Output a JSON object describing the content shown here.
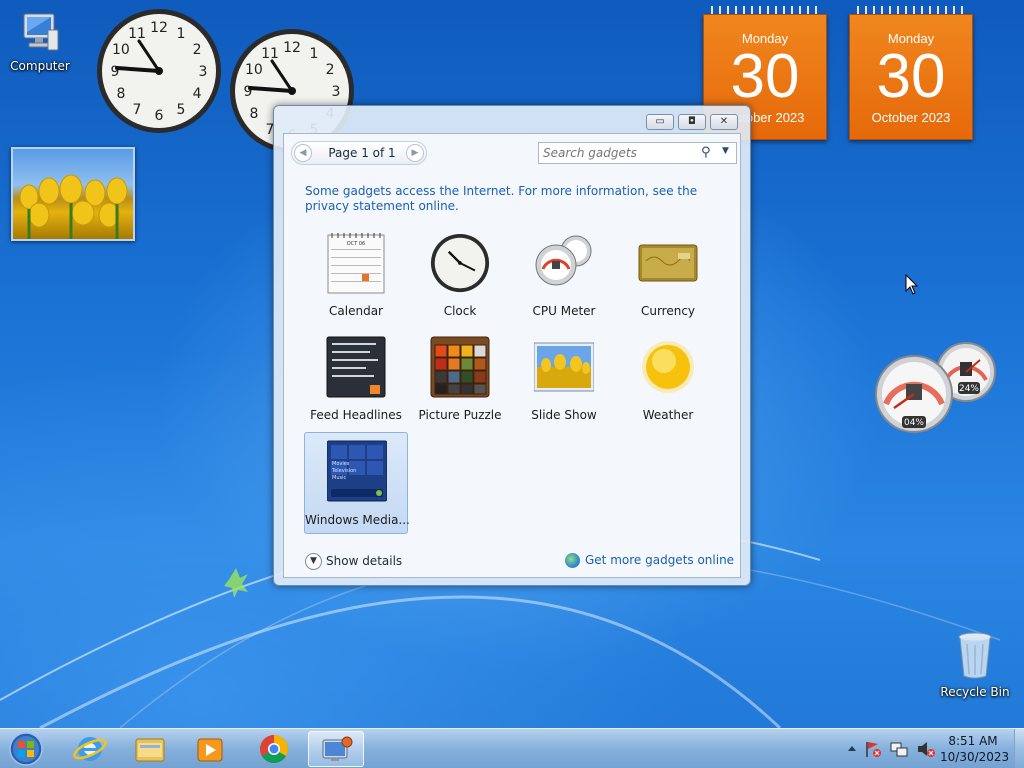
{
  "desktop": {
    "icons": [
      {
        "label": "Computer"
      },
      {
        "label": "Recycle Bin"
      }
    ]
  },
  "calendars": [
    {
      "day": "Monday",
      "date": "30",
      "month": "October 2023"
    },
    {
      "day": "Monday",
      "date": "30",
      "month": "October 2023"
    }
  ],
  "clock_numbers": [
    "12",
    "1",
    "2",
    "3",
    "4",
    "5",
    "6",
    "7",
    "8",
    "9",
    "10",
    "11"
  ],
  "cpu_meter": {
    "cpu": "04%",
    "memory": "24%"
  },
  "gallery": {
    "window_buttons": {
      "minimize": "▭",
      "restore": "◘",
      "close": "✕"
    },
    "pager_label": "Page 1 of 1",
    "search_placeholder": "Search gadgets",
    "notice": "Some gadgets access the Internet.  For more information, see the privacy statement online.",
    "items": [
      {
        "label": "Calendar"
      },
      {
        "label": "Clock"
      },
      {
        "label": "CPU Meter"
      },
      {
        "label": "Currency"
      },
      {
        "label": "Feed Headlines"
      },
      {
        "label": "Picture Puzzle"
      },
      {
        "label": "Slide Show"
      },
      {
        "label": "Weather"
      },
      {
        "label": "Windows Media..."
      }
    ],
    "calendar_thumb_month": "OCT 06",
    "media_thumb_lines": [
      "Movies",
      "Television",
      "Music"
    ],
    "show_details": "Show details",
    "get_more": "Get more gadgets online"
  },
  "taskbar": {
    "time": "8:51 AM",
    "date": "10/30/2023",
    "pinned": [
      "internet-explorer-icon",
      "file-explorer-icon",
      "media-player-icon",
      "chrome-icon",
      "gadgets-icon"
    ]
  },
  "colors": {
    "calendar_orange": "#e6690a",
    "link_blue": "#1b5fb5",
    "desktop_blue": "#1e6ed4"
  }
}
